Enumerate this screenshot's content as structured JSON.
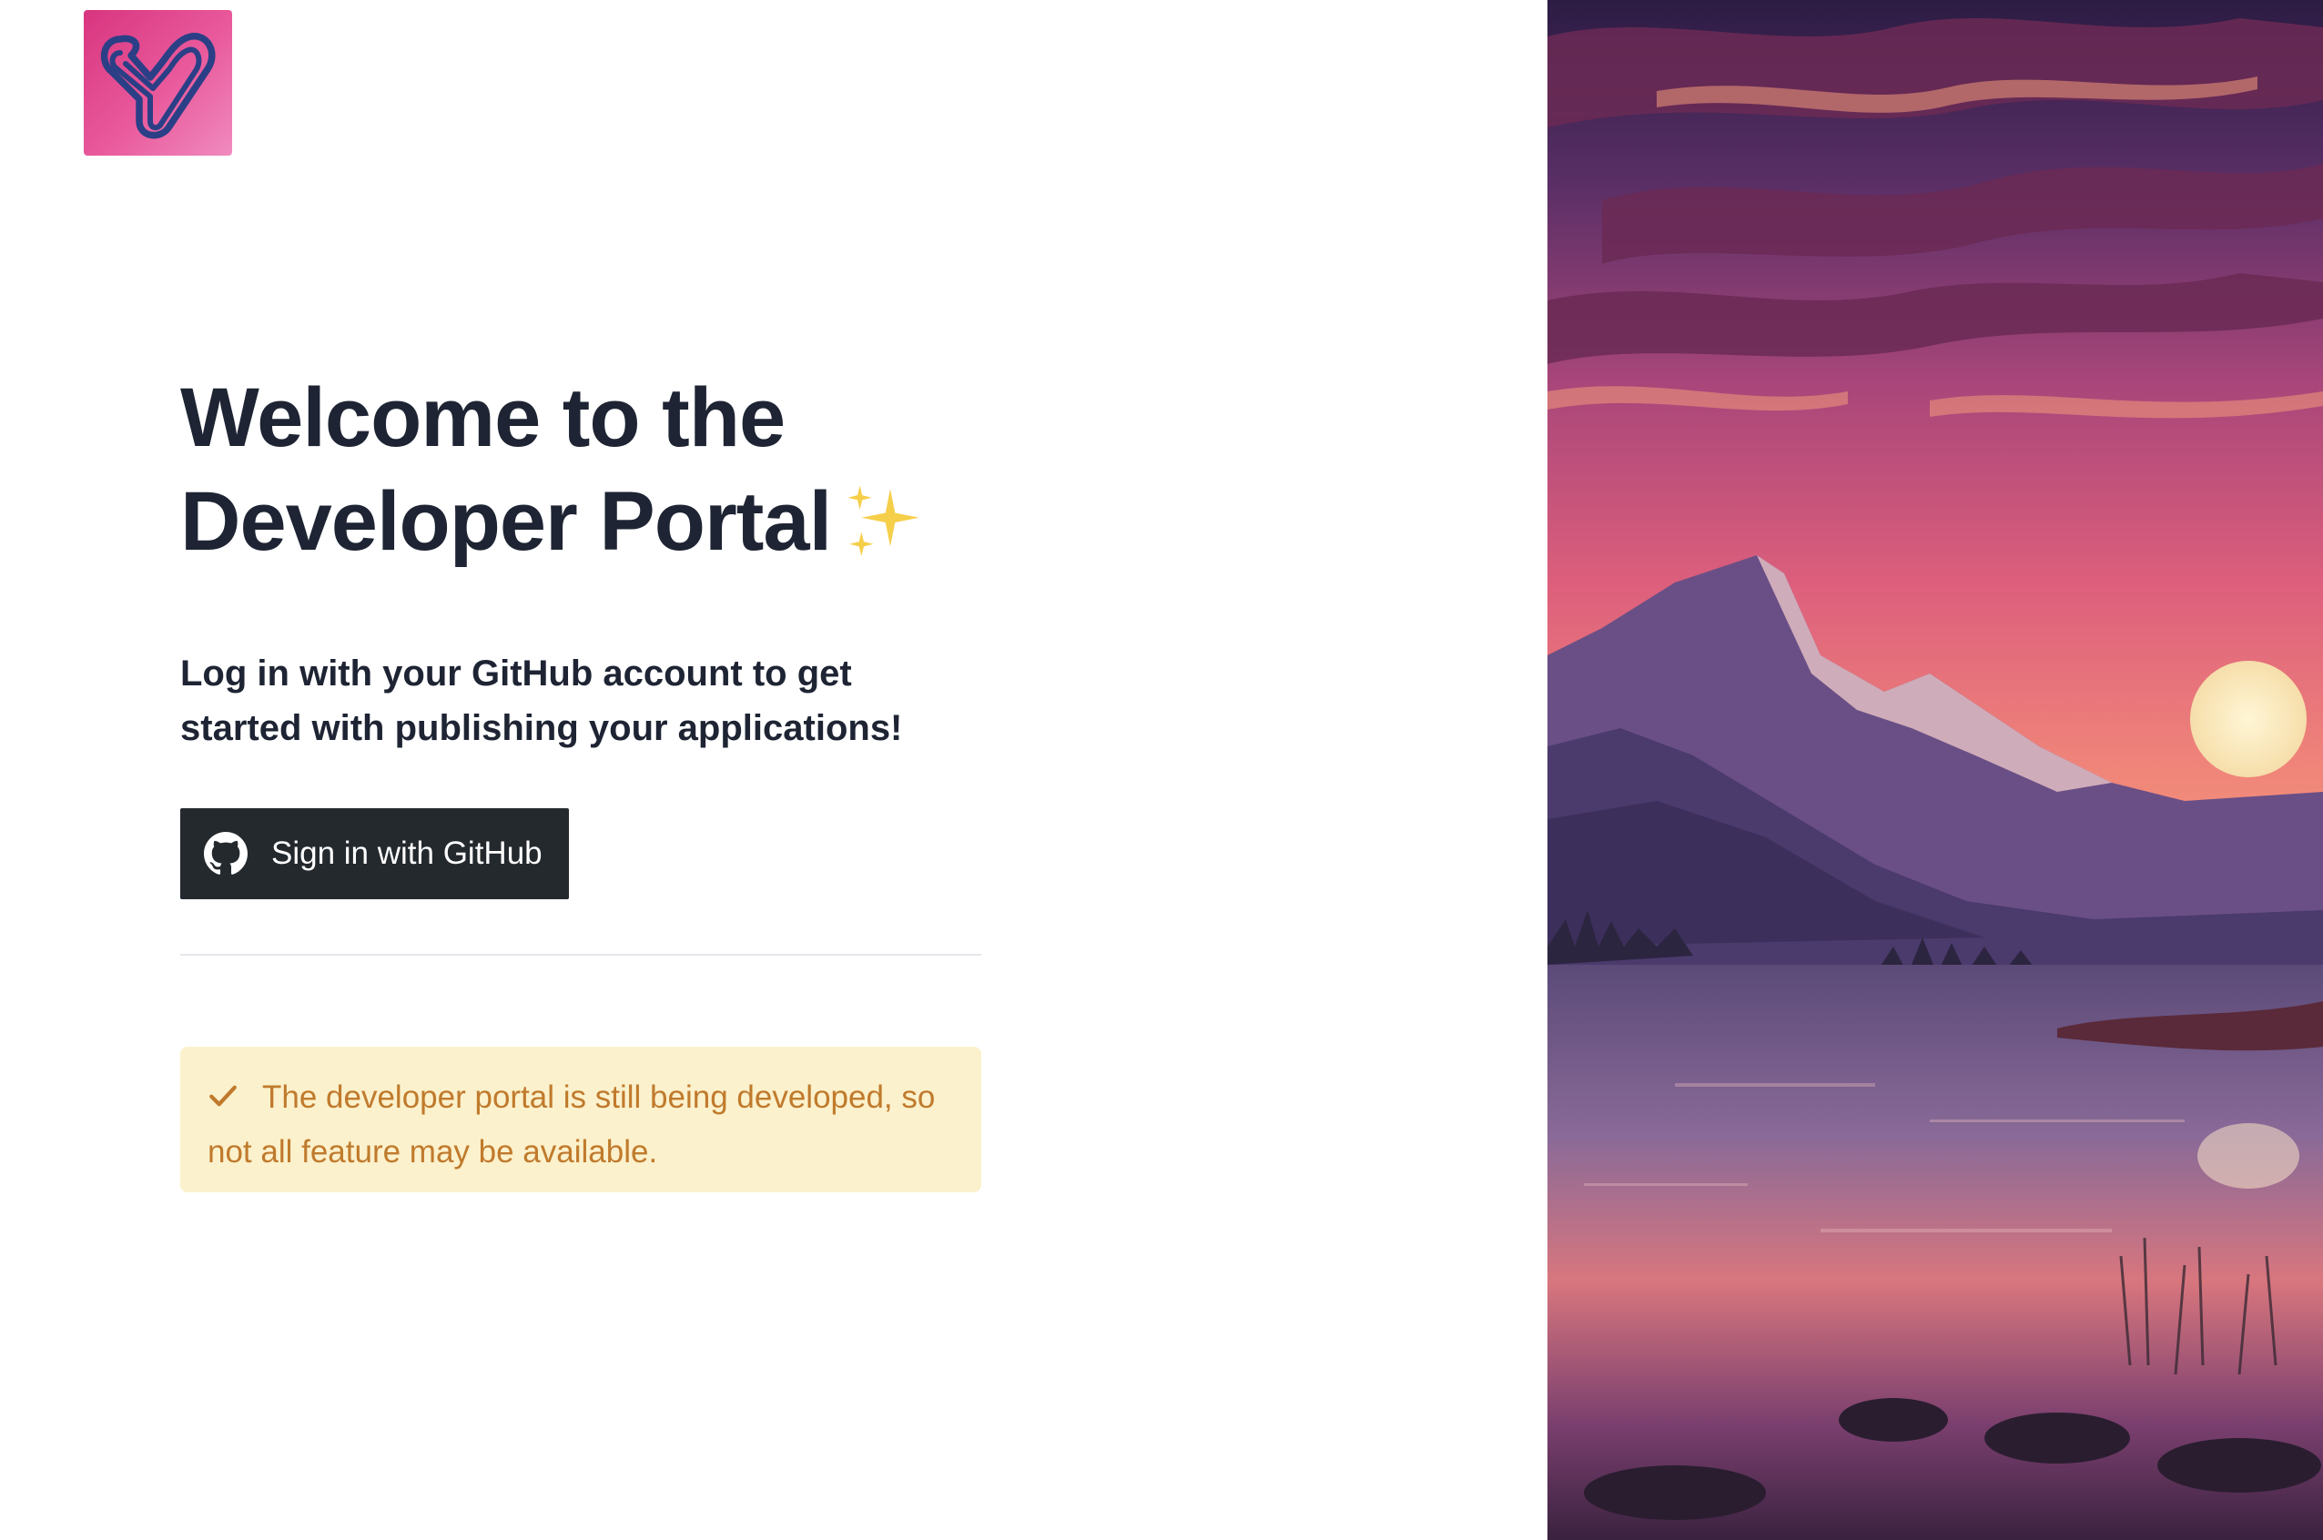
{
  "brand": {
    "logo_icon": "portal-logo-icon",
    "colors": {
      "logo_pink": "#e0488c",
      "logo_stroke": "#2b3f86"
    }
  },
  "hero": {
    "title_line1": "Welcome to the",
    "title_line2": "Developer Portal",
    "title_emoji_icon": "sparkles-icon",
    "subtitle": "Log in with your GitHub account to get started with publishing your applications!"
  },
  "signin": {
    "button_label": "Sign in with GitHub",
    "button_icon": "github-icon",
    "button_color": "#24292e"
  },
  "notice": {
    "icon": "check-icon",
    "text": "The developer portal is still being developed, so not all feature may be available.",
    "background": "#fbf1cc",
    "text_color": "#c07a2c"
  },
  "illustration": {
    "description_icon": "mountain-sunset-illustration"
  },
  "theme": {
    "heading_color": "#1e2433",
    "divider_color": "#e5e7eb"
  }
}
